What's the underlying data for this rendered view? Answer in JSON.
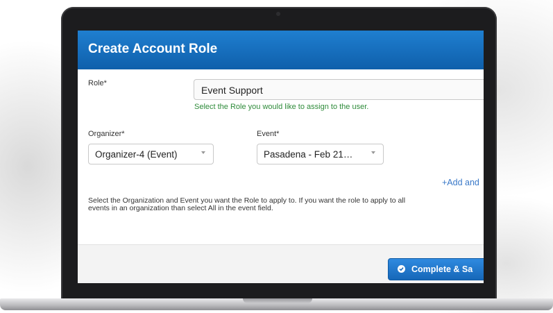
{
  "dialog": {
    "title": "Create Account Role",
    "role": {
      "label": "Role*",
      "value": "Event Support",
      "hint": "Select the Role you would like to assign to the user."
    },
    "organizer": {
      "label": "Organizer*",
      "value": "Organizer-4 (Event)"
    },
    "event": {
      "label": "Event*",
      "value": "Pasadena - Feb 21…"
    },
    "add_link": "+Add and",
    "help_text": "Select the Organization and Event you want the Role to apply to. If you want the role to apply to all events in an organization than select All in the event field.",
    "footer": {
      "complete_label": "Complete & Sa"
    }
  },
  "colors": {
    "header_blue": "#1667b8",
    "hint_green": "#2e8b3a",
    "link_blue": "#3a79c8",
    "button_blue": "#2f8ae0"
  },
  "icons": {
    "complete_button": "check-circle-icon",
    "select_caret": "caret-down-icon"
  }
}
